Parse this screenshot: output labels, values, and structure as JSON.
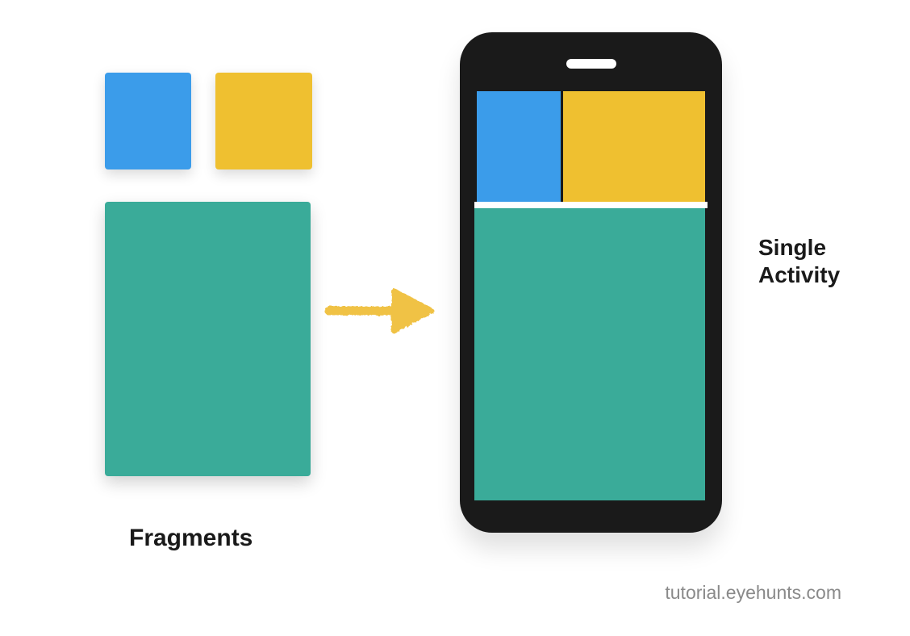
{
  "labels": {
    "fragments": "Fragments",
    "single_activity_line1": "Single",
    "single_activity_line2": "Activity",
    "watermark": "tutorial.eyehunts.com"
  },
  "colors": {
    "blue": "#3b9cea",
    "yellow": "#efc030",
    "teal": "#3aab99",
    "phone_body": "#1a1a1a",
    "arrow": "#f0c244"
  },
  "diagram": {
    "description": "Three colored Android fragments (blue, yellow, teal) combined with an arrow into one phone screen representing a single Activity hosting multiple fragments.",
    "left_fragments": [
      "blue-small",
      "yellow-small",
      "teal-large"
    ],
    "right_phone_screen_layout": [
      "blue-top-left",
      "yellow-top-right",
      "teal-bottom"
    ]
  }
}
